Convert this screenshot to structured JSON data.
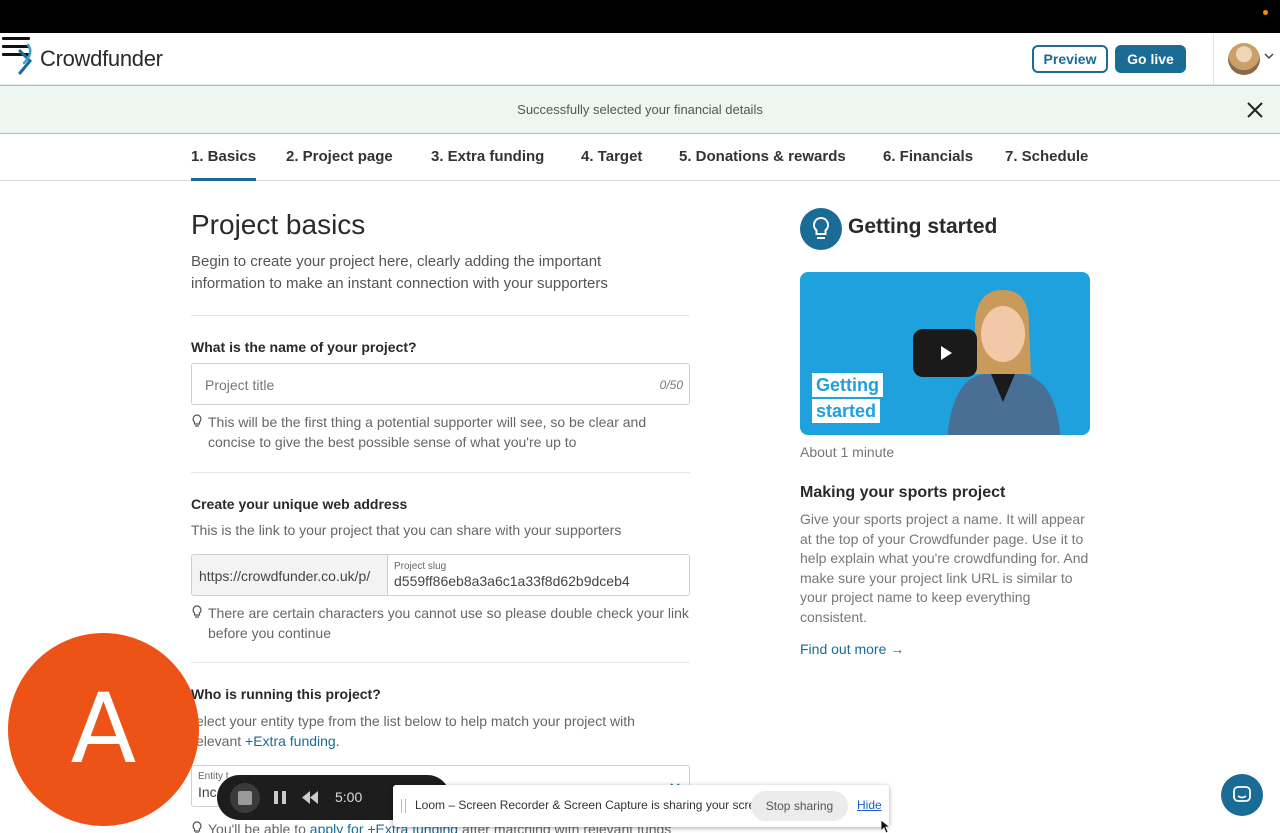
{
  "header": {
    "logo_text": "Crowdfunder",
    "preview_label": "Preview",
    "golive_label": "Go live"
  },
  "banner": {
    "text": "Successfully selected your financial details"
  },
  "steps": [
    {
      "label": "1. Basics",
      "active": true
    },
    {
      "label": "2. Project page"
    },
    {
      "label": "3. Extra funding"
    },
    {
      "label": "4. Target"
    },
    {
      "label": "5. Donations & rewards"
    },
    {
      "label": "6. Financials"
    },
    {
      "label": "7. Schedule"
    }
  ],
  "main": {
    "title": "Project basics",
    "intro": "Begin to create your project here, clearly adding the important information to make an instant connection with your supporters",
    "name_section": {
      "label": "What is the name of your project?",
      "placeholder": "Project title",
      "count": "0/50",
      "tip": "This will be the first thing a potential supporter will see, so be clear and concise to give the best possible sense of what you're up to"
    },
    "url_section": {
      "label": "Create your unique web address",
      "help": "This is the link to your project that you can share with your supporters",
      "prefix": "https://crowdfunder.co.uk/p/",
      "slug_label": "Project slug",
      "slug_value": "d559ff86eb8a3a6c1a33f8d62b9dceb4",
      "tip": "There are certain characters you cannot use so please double check your link before you continue"
    },
    "entity_section": {
      "label": "Who is running this project?",
      "help_prefix": "elect your entity type from the list below to help match your project with",
      "help_line2_prefix": "elevant ",
      "help_link": "+Extra funding.",
      "select_label": "Entity t",
      "select_value": "Inc",
      "bottom_tip_prefix": "You'll be able to ",
      "bottom_tip_link": "apply for +Extra funding",
      "bottom_tip_suffix": " after matching with relevant funds"
    }
  },
  "sidebar": {
    "title": "Getting started",
    "video_caption_line1": "Getting",
    "video_caption_line2": "started",
    "video_duration": "About 1 minute",
    "heading": "Making your sports project",
    "paragraph": "Give your sports project a name. It will appear at the top of your Crowdfunder page. Use it to help explain what you're crowdfunding for. And make sure your project link URL is similar to your project name to keep everything consistent.",
    "link": "Find out more →"
  },
  "loom": {
    "avatar_letter": "A",
    "timer": "5:00",
    "share_message": "Loom – Screen Recorder & Screen Capture is sharing your screen.",
    "stop_sharing": "Stop sharing",
    "hide": "Hide"
  },
  "colors": {
    "brand": "#1a6b96",
    "banner_bg": "#eef6f1",
    "loom_orange": "#ed5316"
  }
}
